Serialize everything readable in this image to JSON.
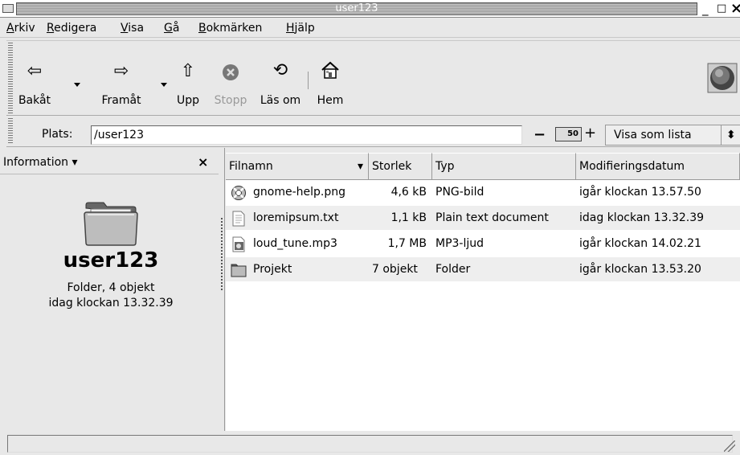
{
  "window": {
    "title": "user123",
    "buttons": {
      "minimize": "_",
      "maximize": "□",
      "close": "×"
    }
  },
  "menubar": {
    "items": [
      {
        "mnemonic": "A",
        "rest": "rkiv"
      },
      {
        "mnemonic": "R",
        "rest": "edigera"
      },
      {
        "mnemonic": "V",
        "rest": "isa"
      },
      {
        "mnemonic": "G",
        "rest": "å"
      },
      {
        "mnemonic": "B",
        "rest": "okmärken"
      },
      {
        "mnemonic": "H",
        "rest": "jälp"
      }
    ]
  },
  "toolbar": {
    "back": {
      "label": "Bakåt",
      "icon": "⇦"
    },
    "forward": {
      "label": "Framåt",
      "icon": "⇨"
    },
    "up": {
      "label": "Upp",
      "icon": "⇧"
    },
    "stop": {
      "label": "Stopp",
      "icon": "✕"
    },
    "reload": {
      "label": "Läs om",
      "icon": "⟲"
    },
    "home": {
      "label": "Hem",
      "icon": "⌂"
    }
  },
  "location": {
    "label": "Plats:",
    "value": "/user123",
    "zoom_value": "50",
    "zoom_minus": "−",
    "zoom_plus": "+",
    "view_as": "Visa som lista",
    "view_as_arrows": "⬍"
  },
  "sidepane": {
    "title": "Information ▾",
    "close": "×",
    "folder_name": "user123",
    "folder_info": "Folder, 4 objekt",
    "folder_date": "idag klockan 13.32.39"
  },
  "filelist": {
    "columns": {
      "name": "Filnamn",
      "sort_arrow": "▾",
      "size": "Storlek",
      "type": "Typ",
      "date": "Modifieringsdatum"
    },
    "rows": [
      {
        "name": "gnome-help.png",
        "size": "4,6 kB",
        "type": "PNG-bild",
        "date": "igår klockan 13.57.50",
        "icon": "lifebuoy-icon"
      },
      {
        "name": "loremipsum.txt",
        "size": "1,1 kB",
        "type": "Plain text document",
        "date": "idag klockan 13.32.39",
        "icon": "text-file-icon"
      },
      {
        "name": "loud_tune.mp3",
        "size": "1,7 MB",
        "type": "MP3-ljud",
        "date": "igår klockan 14.02.21",
        "icon": "audio-file-icon"
      },
      {
        "name": "Projekt",
        "size": "7 objekt",
        "type": "Folder",
        "date": "igår klockan 13.53.20",
        "icon": "folder-icon"
      }
    ]
  },
  "statusbar": {
    "text": ""
  }
}
